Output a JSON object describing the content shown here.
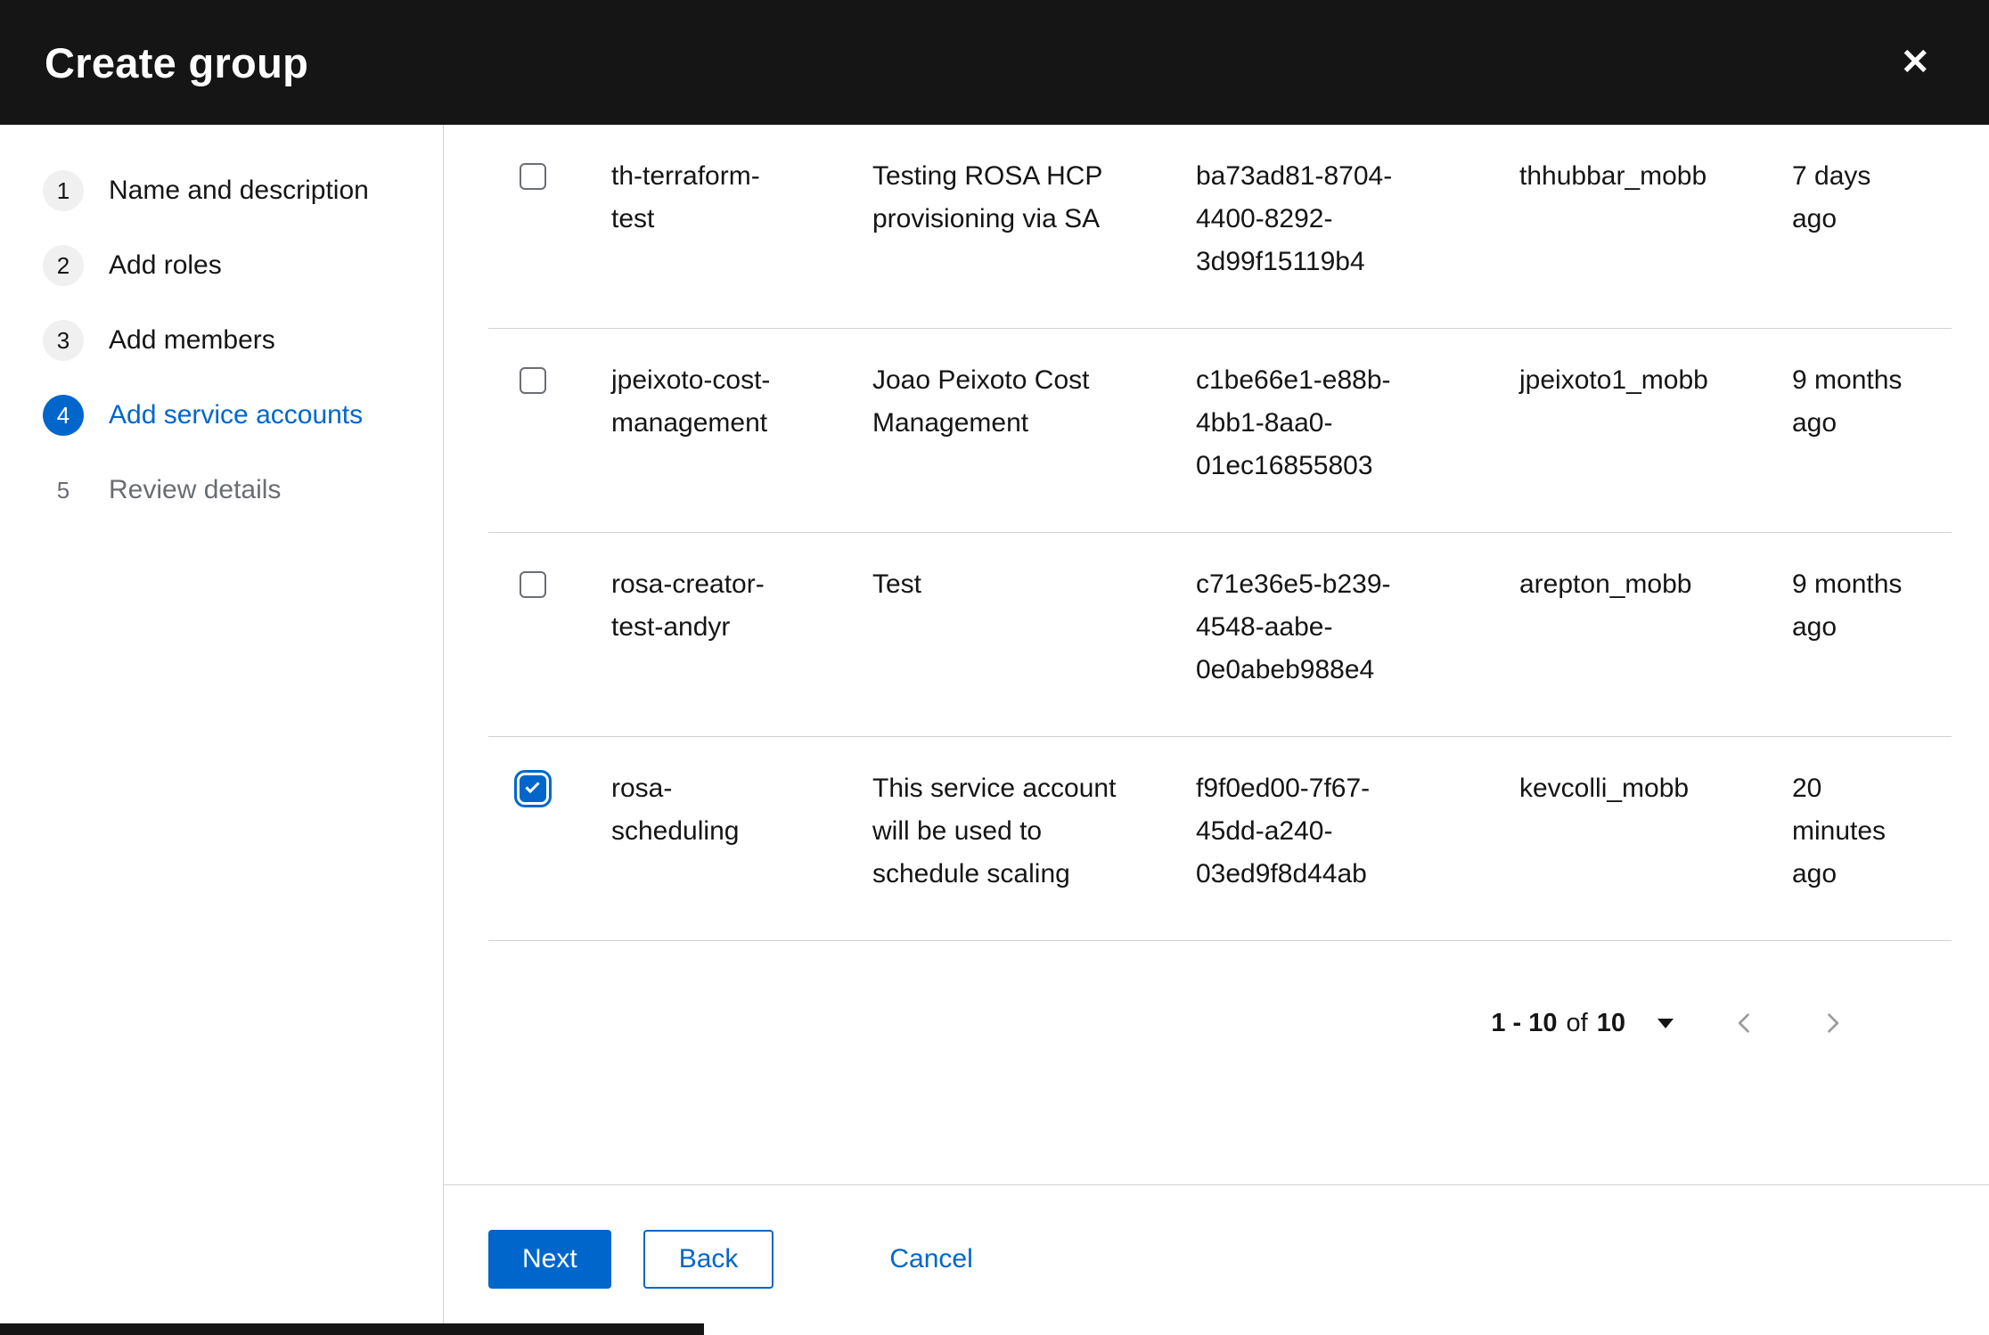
{
  "modal": {
    "title": "Create group",
    "icons": {
      "close": "✕"
    }
  },
  "wizard": {
    "steps": [
      {
        "number": "1",
        "label": "Name and description",
        "state": "visited"
      },
      {
        "number": "2",
        "label": "Add roles",
        "state": "visited"
      },
      {
        "number": "3",
        "label": "Add members",
        "state": "visited"
      },
      {
        "number": "4",
        "label": "Add service accounts",
        "state": "current"
      },
      {
        "number": "5",
        "label": "Review details",
        "state": "future"
      }
    ]
  },
  "table": {
    "rows": [
      {
        "checked": false,
        "name": "th-terraform-test",
        "description": "Testing ROSA HCP provisioning via SA",
        "client_id": "ba73ad81-8704-4400-8292-3d99f15119b4",
        "owner": "thhubbar_mobb",
        "time_created": "7 days ago"
      },
      {
        "checked": false,
        "name": "jpeixoto-cost-management",
        "description": "Joao Peixoto Cost Management",
        "client_id": "c1be66e1-e88b-4bb1-8aa0-01ec16855803",
        "owner": "jpeixoto1_mobb",
        "time_created": "9 months ago"
      },
      {
        "checked": false,
        "name": "rosa-creator-test-andyr",
        "description": "Test",
        "client_id": "c71e36e5-b239-4548-aabe-0e0abeb988e4",
        "owner": "arepton_mobb",
        "time_created": "9 months ago"
      },
      {
        "checked": true,
        "name": "rosa-scheduling",
        "description": "This service account will be used to schedule scaling",
        "client_id": "f9f0ed00-7f67-45dd-a240-03ed9f8d44ab",
        "owner": "kevcolli_mobb",
        "time_created": "20 minutes ago"
      }
    ]
  },
  "pagination": {
    "range": "1 - 10",
    "of": "of",
    "total": "10"
  },
  "footer": {
    "next": "Next",
    "back": "Back",
    "cancel": "Cancel"
  },
  "colors": {
    "primary_blue": "#0066cc",
    "header_black": "#151515",
    "border_gray": "#d2d2d2",
    "muted_text": "#6a6e73"
  }
}
